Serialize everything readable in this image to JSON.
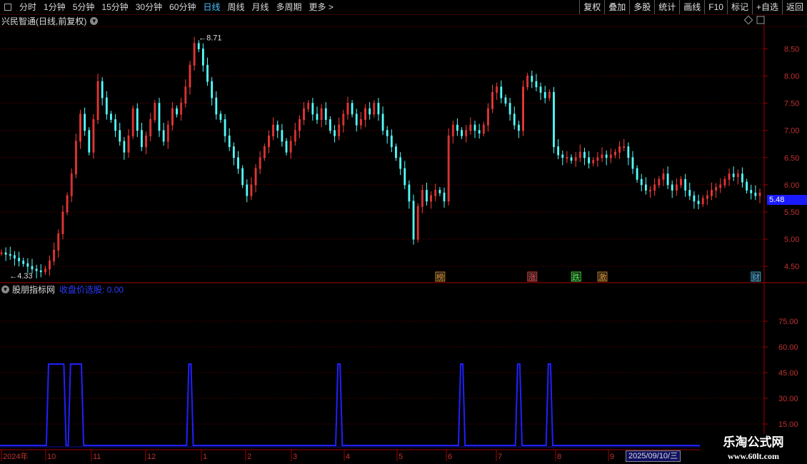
{
  "toolbar": {
    "periods": [
      "分时",
      "1分钟",
      "5分钟",
      "15分钟",
      "30分钟",
      "60分钟",
      "日线",
      "周线",
      "月线",
      "多周期",
      "更多 >"
    ],
    "active_period": "日线",
    "right_buttons": [
      "复权",
      "叠加",
      "多股",
      "统计",
      "画线",
      "F10",
      "标记",
      "+自选",
      "返回"
    ]
  },
  "chart_title": "兴民智通(日线,前复权)",
  "current_price": "5.48",
  "price_axis": [
    "8.50",
    "8.00",
    "7.50",
    "7.00",
    "6.50",
    "6.00",
    "5.50",
    "5.00",
    "4.50"
  ],
  "high_label": "8.71",
  "low_label": "4.33",
  "event_markers": [
    {
      "text": "榜",
      "color": "#e09020"
    },
    {
      "text": "涨",
      "color": "#ff4040"
    },
    {
      "text": "跌",
      "color": "#40ff40"
    },
    {
      "text": "激",
      "color": "#e09020"
    },
    {
      "text": "财",
      "color": "#40c0ff"
    }
  ],
  "indicator": {
    "name": "股朋指标网",
    "series_label": "收盘价选股: 0.00",
    "axis": [
      "75.00",
      "60.00",
      "45.00",
      "30.00",
      "15.00"
    ]
  },
  "time_axis": {
    "labels": [
      "2024年",
      "10",
      "11",
      "12",
      "1",
      "2",
      "3",
      "4",
      "5",
      "6",
      "7",
      "8",
      "9"
    ],
    "current_date": "2025/09/10/三"
  },
  "watermark": {
    "line1": "乐淘公式网",
    "line2": "www.60lt.com"
  },
  "colors": {
    "up": "#ff3c3c",
    "down": "#54ffff",
    "indicator": "#2020ff",
    "grid": "#7a0000",
    "axis": "#a00000"
  },
  "chart_data": {
    "type": "line",
    "series": [
      {
        "values": [
          4.75,
          4.72,
          4.7,
          4.65,
          4.6,
          4.55,
          4.5,
          4.45,
          4.42,
          4.4,
          4.45,
          4.6,
          4.8,
          5.1,
          5.5,
          5.8,
          6.2,
          6.8,
          7.3,
          7.0,
          6.6,
          7.2,
          7.9,
          7.6,
          7.3,
          7.2,
          7.0,
          6.8,
          6.6,
          6.9,
          7.4,
          7.0,
          6.7,
          6.9,
          7.2,
          7.5,
          7.0,
          6.8,
          7.1,
          7.4,
          7.3,
          7.5,
          7.8,
          8.2,
          8.6,
          8.5,
          8.2,
          7.9,
          7.6,
          7.3,
          7.2,
          6.9,
          6.7,
          6.5,
          6.3,
          6.0,
          5.8,
          6.0,
          6.3,
          6.5,
          6.7,
          6.9,
          7.1,
          7.0,
          6.8,
          6.6,
          6.8,
          7.0,
          7.2,
          7.4,
          7.5,
          7.3,
          7.2,
          7.4,
          7.2,
          7.0,
          6.9,
          7.1,
          7.3,
          7.5,
          7.3,
          7.1,
          7.2,
          7.4,
          7.3,
          7.5,
          7.3,
          7.0,
          6.9,
          6.7,
          6.5,
          6.3,
          6.0,
          5.7,
          5.0,
          5.6,
          5.9,
          5.7,
          5.8,
          5.9,
          5.85,
          5.7,
          6.9,
          7.1,
          7.0,
          6.9,
          7.0,
          7.1,
          7.0,
          6.95,
          7.1,
          7.4,
          7.7,
          7.8,
          7.6,
          7.5,
          7.3,
          7.1,
          7.0,
          7.8,
          8.0,
          7.9,
          7.8,
          7.7,
          7.6,
          7.7,
          6.7,
          6.55,
          6.5,
          6.5,
          6.45,
          6.5,
          6.6,
          6.5,
          6.4,
          6.45,
          6.5,
          6.55,
          6.5,
          6.55,
          6.6,
          6.7,
          6.7,
          6.5,
          6.3,
          6.1,
          6.0,
          5.9,
          5.9,
          6.0,
          6.1,
          6.2,
          6.0,
          5.9,
          6.0,
          6.1,
          5.9,
          5.8,
          5.7,
          5.65,
          5.75,
          5.8,
          5.9,
          5.95,
          6.0,
          6.1,
          6.2,
          6.15,
          6.2,
          6.05,
          5.9,
          5.85,
          5.8,
          5.85
        ]
      }
    ],
    "signal": [
      0,
      0,
      0,
      0,
      0,
      0,
      0,
      0,
      0,
      0,
      0,
      1,
      1,
      1,
      1,
      0,
      1,
      1,
      1,
      0,
      0,
      0,
      0,
      0,
      0,
      0,
      0,
      0,
      0,
      0,
      0,
      0,
      0,
      0,
      0,
      0,
      0,
      0,
      0,
      0,
      0,
      0,
      0,
      1,
      0,
      0,
      0,
      0,
      0,
      0,
      0,
      0,
      0,
      0,
      0,
      0,
      0,
      0,
      0,
      0,
      0,
      0,
      0,
      0,
      0,
      0,
      0,
      0,
      0,
      0,
      0,
      0,
      0,
      0,
      0,
      0,
      0,
      1,
      0,
      0,
      0,
      0,
      0,
      0,
      0,
      0,
      0,
      0,
      0,
      0,
      0,
      0,
      0,
      0,
      0,
      0,
      0,
      0,
      0,
      0,
      0,
      0,
      0,
      0,
      0,
      1,
      0,
      0,
      0,
      0,
      0,
      0,
      0,
      0,
      0,
      0,
      0,
      0,
      1,
      0,
      0,
      0,
      0,
      0,
      0,
      1,
      0,
      0,
      0,
      0,
      0,
      0,
      0,
      0,
      0,
      0,
      0,
      0,
      0,
      0,
      0,
      0,
      0,
      0,
      0,
      0,
      0,
      0,
      0,
      0,
      0,
      0,
      0,
      0,
      0,
      0,
      0,
      0,
      0,
      0,
      0,
      0,
      0,
      0,
      0,
      0,
      0,
      0,
      0,
      0,
      0,
      0,
      0,
      0,
      0,
      0,
      0,
      0,
      0
    ],
    "ylim": [
      4.2,
      8.9
    ],
    "indicator_ylim": [
      0,
      90
    ],
    "signal_value": 50
  }
}
